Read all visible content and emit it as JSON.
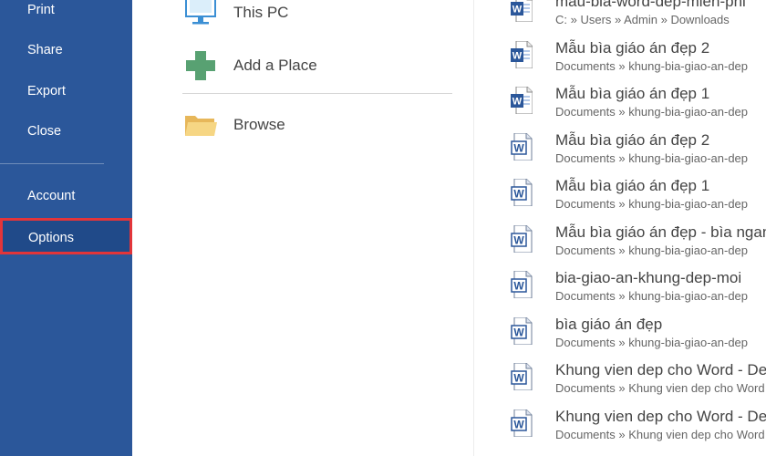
{
  "nav": {
    "items": [
      "Print",
      "Share",
      "Export",
      "Close",
      "Account"
    ],
    "selected": "Options",
    "bg_color": "#2b579a",
    "highlight_color": "#e2353a"
  },
  "places": [
    {
      "label": "This PC",
      "icon": "computer-icon"
    },
    {
      "label": "Add a Place",
      "icon": "plus-icon"
    },
    {
      "label": "Browse",
      "icon": "folder-icon"
    }
  ],
  "recent": [
    {
      "title": "mau-bia-word-dep-mien-phi",
      "path": "C: » Users » Admin » Downloads",
      "icon": "word-doc-icon"
    },
    {
      "title": "Mẫu bìa giáo án đẹp 2",
      "path": "Documents » khung-bia-giao-an-dep",
      "icon": "word-doc-icon"
    },
    {
      "title": "Mẫu bìa giáo án đẹp 1",
      "path": "Documents » khung-bia-giao-an-dep",
      "icon": "word-doc-icon"
    },
    {
      "title": "Mẫu bìa giáo án đẹp 2",
      "path": "Documents » khung-bia-giao-an-dep",
      "icon": "word-legacy-doc-icon"
    },
    {
      "title": "Mẫu bìa giáo án đẹp 1",
      "path": "Documents » khung-bia-giao-an-dep",
      "icon": "word-legacy-doc-icon"
    },
    {
      "title": "Mẫu bìa giáo án đẹp - bìa ngang",
      "path": "Documents » khung-bia-giao-an-dep",
      "icon": "word-legacy-doc-icon"
    },
    {
      "title": "bia-giao-an-khung-dep-moi",
      "path": "Documents » khung-bia-giao-an-dep",
      "icon": "word-legacy-doc-icon"
    },
    {
      "title": "bìa giáo án đẹp",
      "path": "Documents » khung-bia-giao-an-dep",
      "icon": "word-legacy-doc-icon"
    },
    {
      "title": "Khung vien dep cho Word - Dep",
      "path": "Documents » Khung vien dep cho Word",
      "icon": "word-legacy-doc-icon"
    },
    {
      "title": "Khung vien dep cho Word - Dep",
      "path": "Documents » Khung vien dep cho Word",
      "icon": "word-legacy-doc-icon"
    }
  ]
}
